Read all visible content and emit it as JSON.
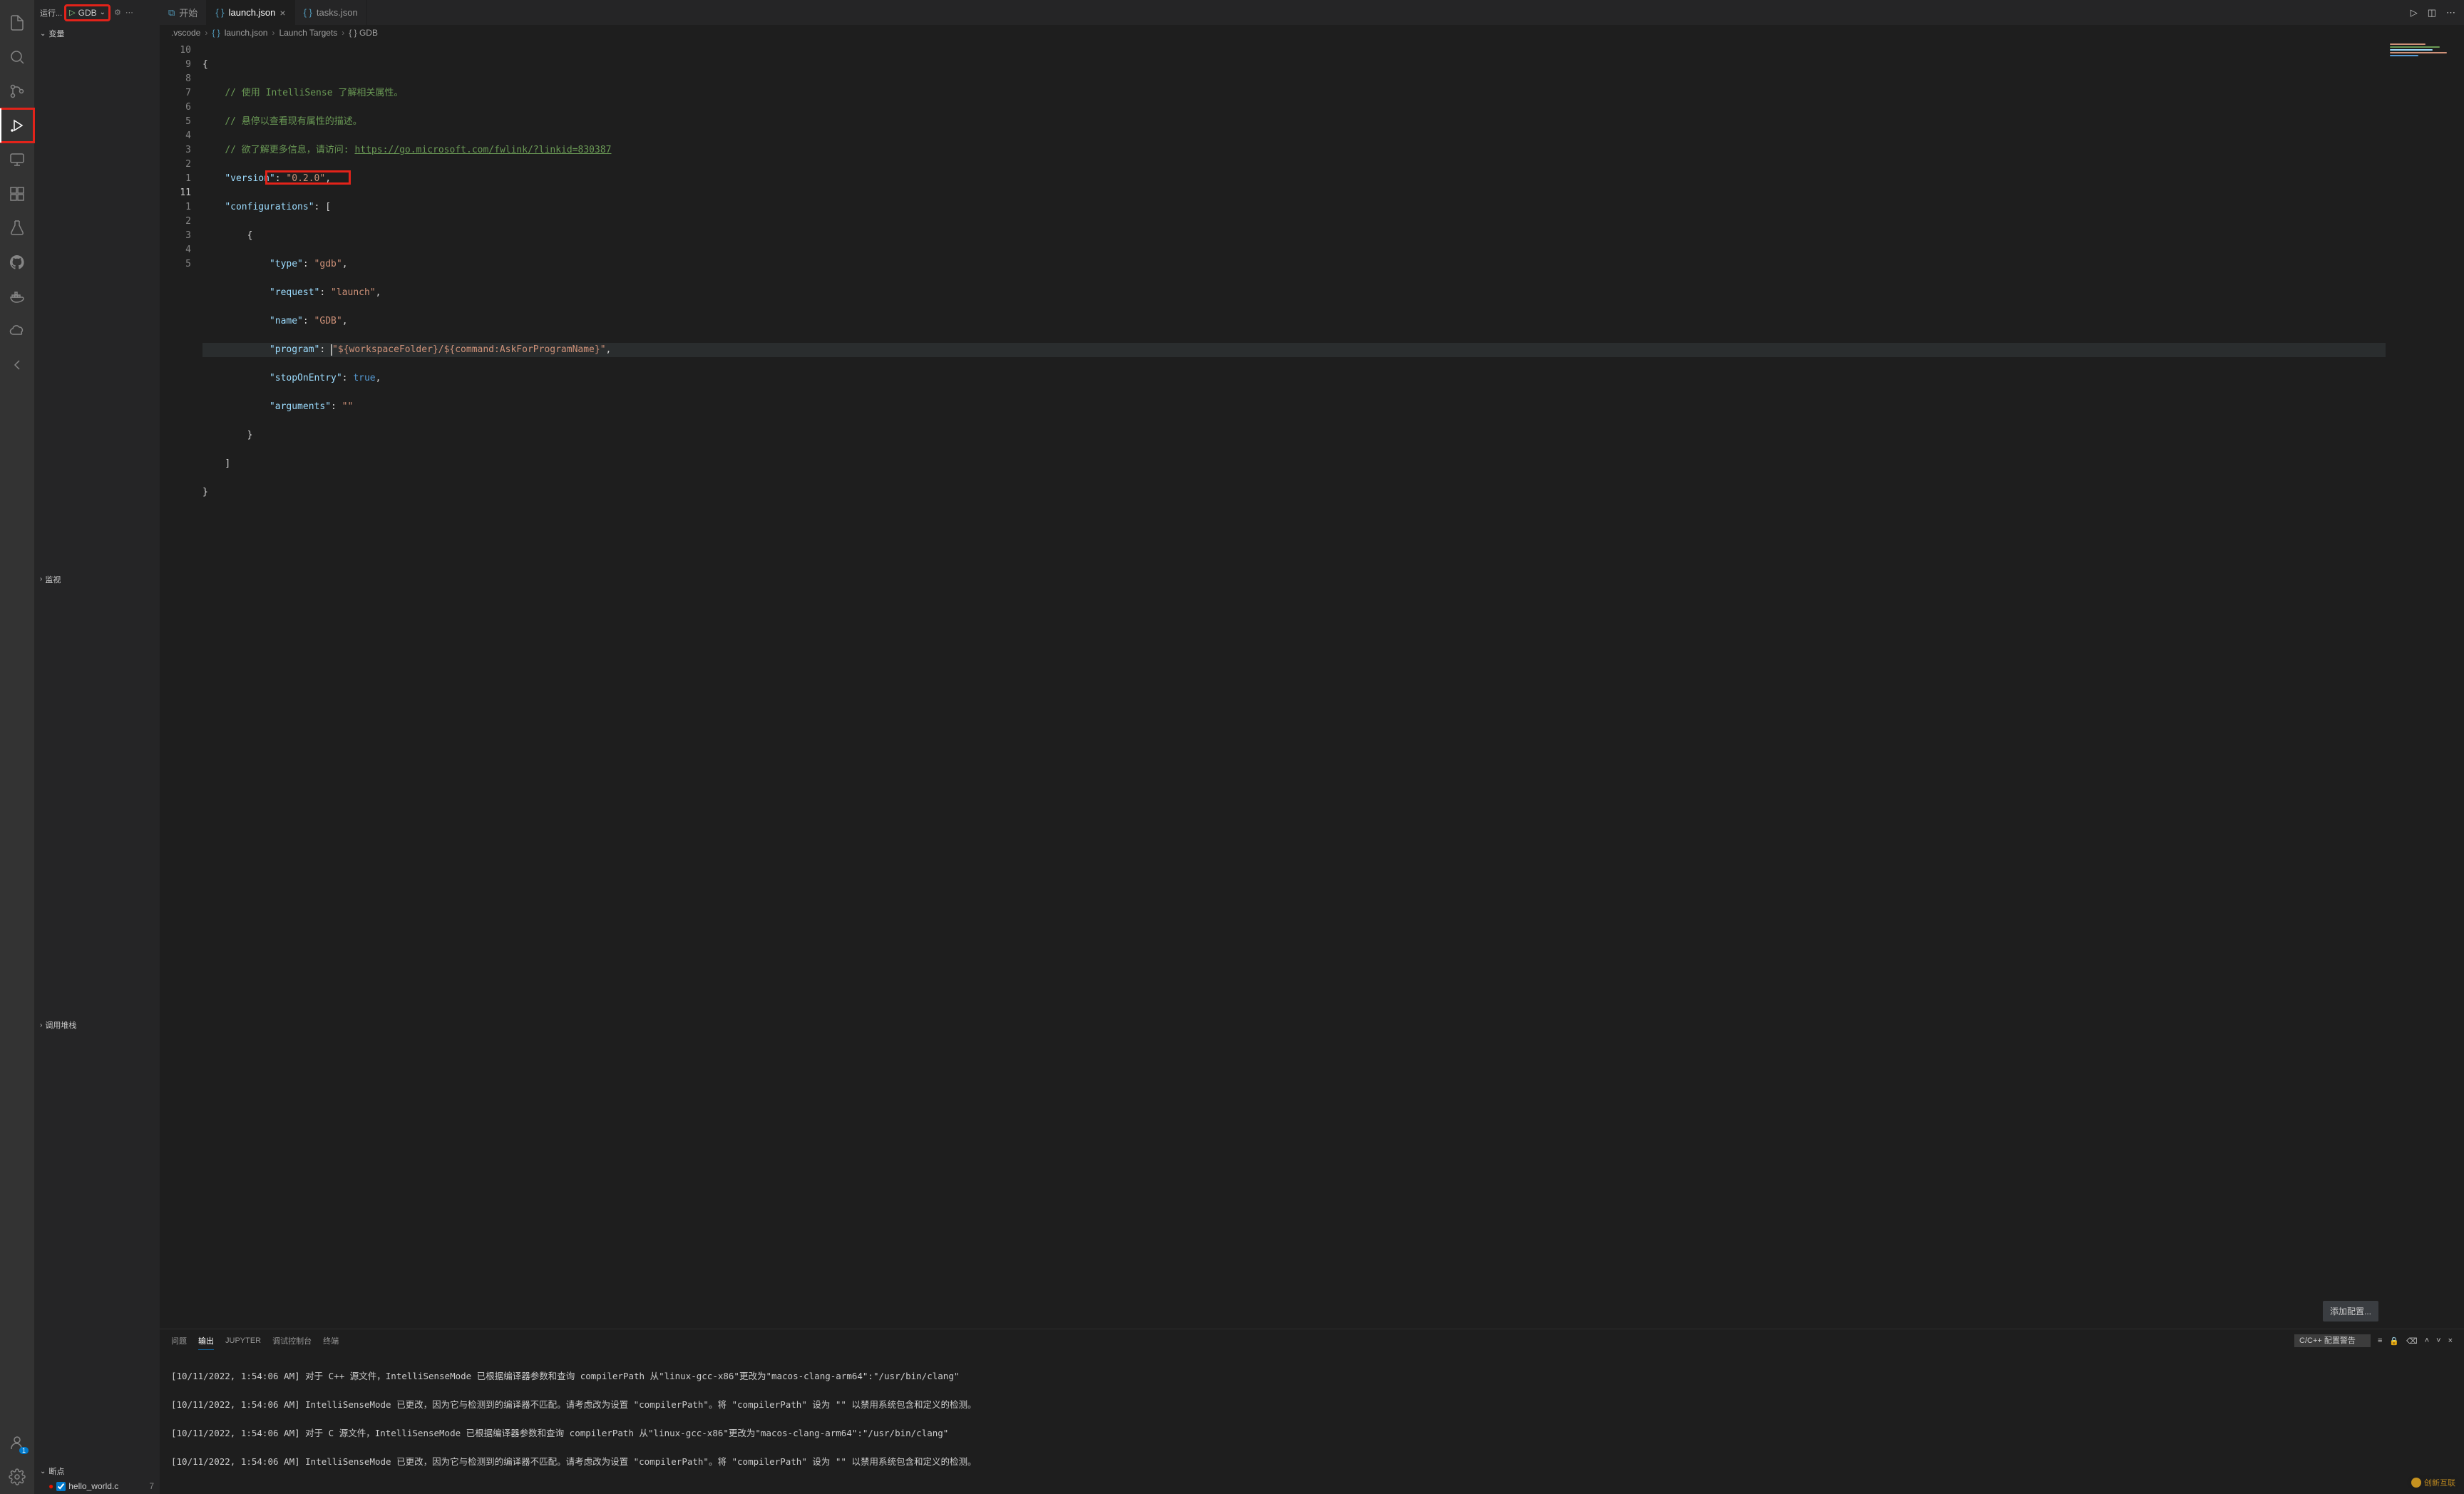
{
  "sidebar": {
    "runLabel": "运行...",
    "config": "GDB",
    "sections": {
      "variables": "变量",
      "watch": "监视",
      "callstack": "调用堆栈",
      "breakpoints": "断点"
    },
    "breakpointItem": "hello_world.c",
    "breakpointLine": "7"
  },
  "accountsBadge": "1",
  "tabs": {
    "start": "开始",
    "launch": "launch.json",
    "tasks": "tasks.json"
  },
  "breadcrumb": {
    "folder": ".vscode",
    "file": "launch.json",
    "sym1": "Launch Targets",
    "sym2": "{ } GDB"
  },
  "gutter": [
    "10",
    "9",
    "8",
    "7",
    "6",
    "5",
    "4",
    "3",
    "2",
    "1",
    "11",
    "1",
    "2",
    "3",
    "4",
    "5"
  ],
  "code": {
    "c1": "// 使用 IntelliSense 了解相关属性。",
    "c2": "// 悬停以查看现有属性的描述。",
    "c3a": "// 欲了解更多信息，请访问: ",
    "c3link": "https://go.microsoft.com/fwlink/?linkid=830387",
    "k_version": "\"version\"",
    "v_version": "\"0.2.0\"",
    "k_config": "\"configurations\"",
    "k_type": "\"type\"",
    "v_type": "\"gdb\"",
    "k_request": "\"request\"",
    "v_request": "\"launch\"",
    "k_name": "\"name\"",
    "v_name": "\"GDB\"",
    "k_program": "\"program\"",
    "v_program": "\"${workspaceFolder}/${command:AskForProgramName}\"",
    "k_stop": "\"stopOnEntry\"",
    "v_stop": "true",
    "k_args": "\"arguments\"",
    "v_args": "\"\""
  },
  "addConfig": "添加配置...",
  "panel": {
    "tabs": {
      "problems": "问题",
      "output": "输出",
      "jupyter": "JUPYTER",
      "debug": "调试控制台",
      "terminal": "终端"
    },
    "selector": "C/C++ 配置警告",
    "lines": [
      "[10/11/2022, 1:54:06 AM] 对于 C++ 源文件，IntelliSenseMode 已根据编译器参数和查询 compilerPath 从\"linux-gcc-x86\"更改为\"macos-clang-arm64\":\"/usr/bin/clang\"",
      "[10/11/2022, 1:54:06 AM] IntelliSenseMode 已更改，因为它与检测到的编译器不匹配。请考虑改为设置 \"compilerPath\"。将 \"compilerPath\" 设为 \"\" 以禁用系统包含和定义的检测。",
      "[10/11/2022, 1:54:06 AM] 对于 C 源文件，IntelliSenseMode 已根据编译器参数和查询 compilerPath 从\"linux-gcc-x86\"更改为\"macos-clang-arm64\":\"/usr/bin/clang\"",
      "[10/11/2022, 1:54:06 AM] IntelliSenseMode 已更改，因为它与检测到的编译器不匹配。请考虑改为设置 \"compilerPath\"。将 \"compilerPath\" 设为 \"\" 以禁用系统包含和定义的检测。"
    ]
  },
  "watermark": "创新互联"
}
